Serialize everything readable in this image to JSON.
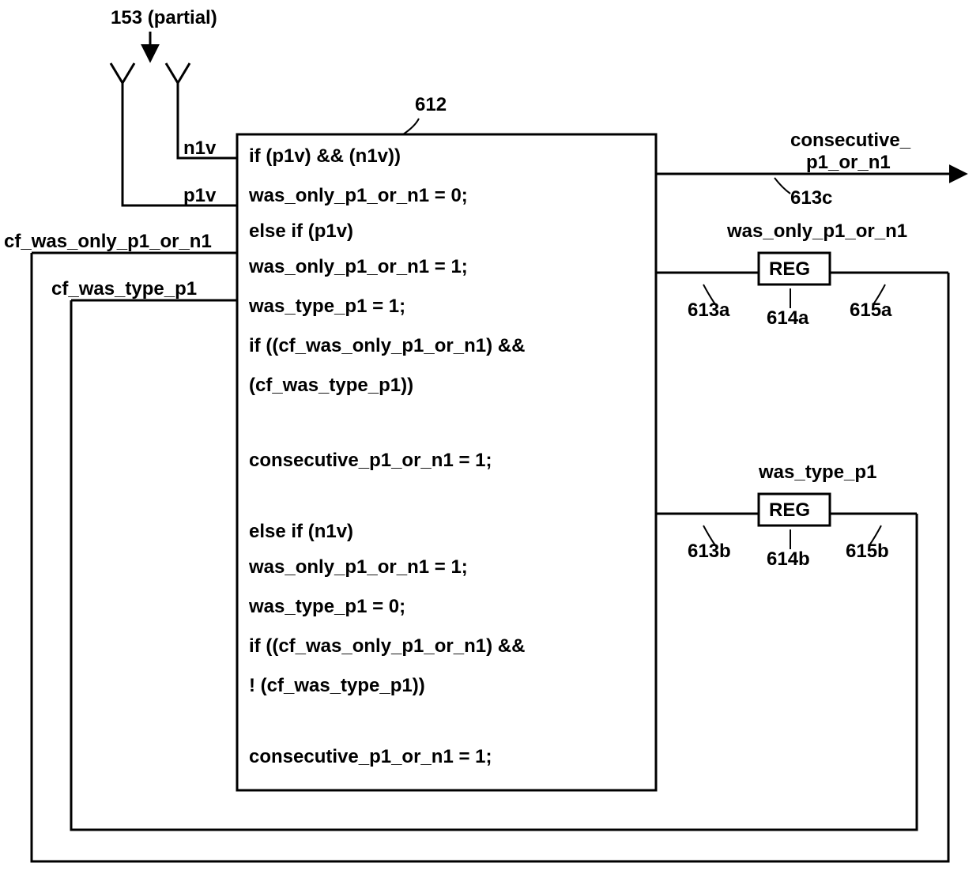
{
  "top_label": "153 (partial)",
  "block_ref": "612",
  "inputs": {
    "n1v": "n1v",
    "p1v": "p1v",
    "cf_was_only": "cf_was_only_p1_or_n1",
    "cf_was_type": "cf_was_type_p1"
  },
  "outputs": {
    "consecutive": "consecutive_\np1_or_n1",
    "consecutive_ref": "613c",
    "was_only": "was_only_p1_or_n1",
    "was_type": "was_type_p1"
  },
  "reg1": {
    "label": "REG",
    "ref_l": "613a",
    "ref_m": "614a",
    "ref_r": "615a"
  },
  "reg2": {
    "label": "REG",
    "ref_l": "613b",
    "ref_m": "614b",
    "ref_r": "615b"
  },
  "code": [
    "if (p1v) && (n1v))",
    "        was_only_p1_or_n1 = 0;",
    "else if (p1v)",
    "            was_only_p1_or_n1 = 1;",
    "            was_type_p1 = 1;",
    "            if ((cf_was_only_p1_or_n1) &&",
    "                 (cf_was_type_p1))",
    "",
    "         consecutive_p1_or_n1 = 1;",
    "",
    "else if (n1v)",
    "            was_only_p1_or_n1 = 1;",
    "            was_type_p1 = 0;",
    "            if ((cf_was_only_p1_or_n1) &&",
    "                ! (cf_was_type_p1))",
    "",
    "         consecutive_p1_or_n1 = 1;"
  ]
}
